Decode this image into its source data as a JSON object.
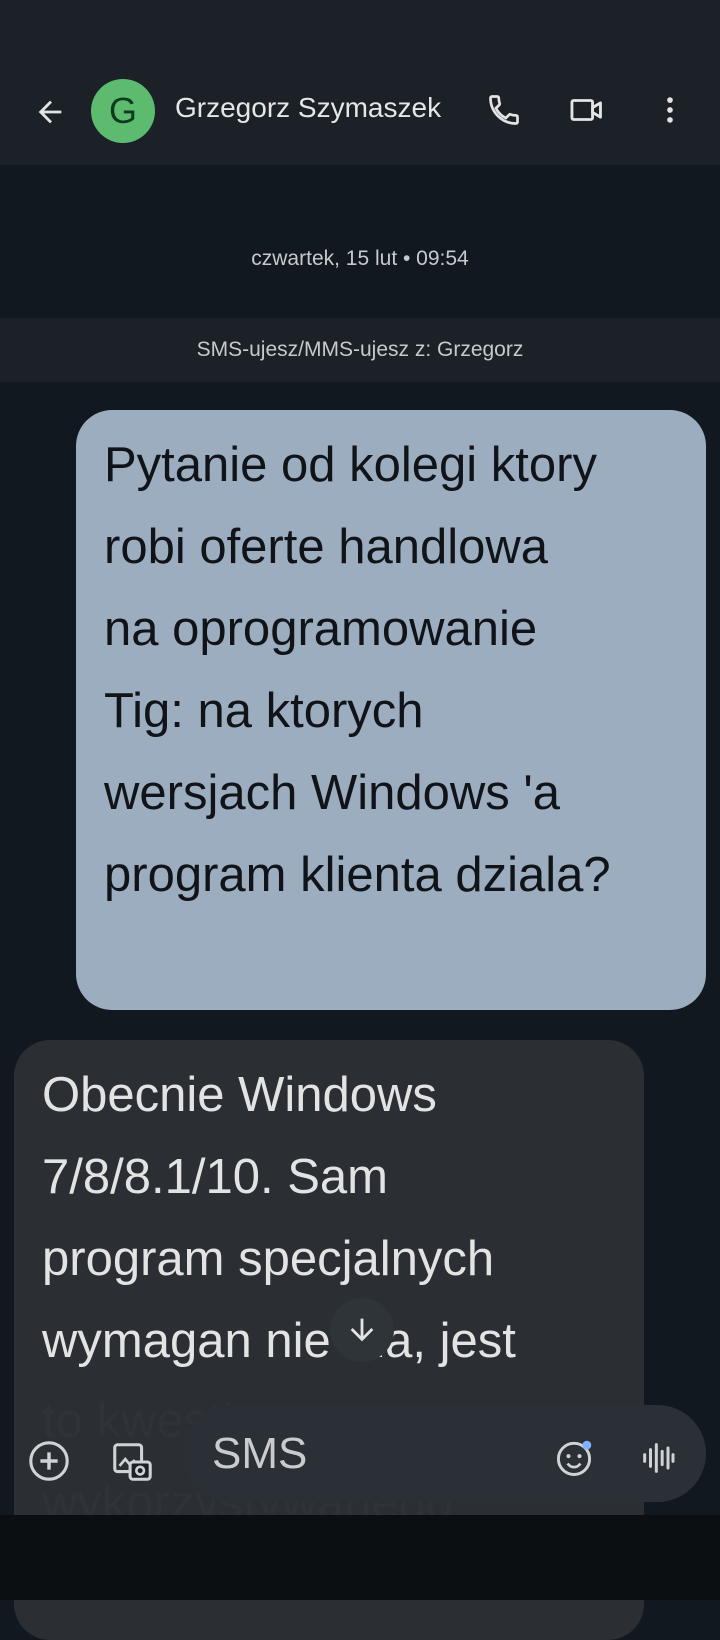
{
  "header": {
    "back_icon": "arrow-back-icon",
    "avatar_letter": "G",
    "avatar_color": "#5dbb6f",
    "contact_name": "Grzegorz Szymaszek",
    "call_icon": "phone-icon",
    "video_icon": "video-camera-icon",
    "more_icon": "more-vert-icon"
  },
  "conversation": {
    "date_label": "czwartek, 15 lut • 09:54",
    "sim_banner": "SMS-ujesz/MMS-ujesz z: Grzegorz",
    "messages": [
      {
        "direction": "outgoing",
        "text": "Pytanie od kolegi ktory\nrobi oferte handlowa\nna oprogramowanie\nTig: na ktorych\nwersjach Windows 'a\nprogram klienta dziala?"
      },
      {
        "direction": "incoming",
        "text": "Obecnie Windows\n7/8/8.1/10. Sam\nprogram specjalnych\nwymagan nie ma, jest",
        "hidden_continuation": "to kwestia\nwykorzystywanego\nframeworka - Electron"
      }
    ],
    "scroll_down_icon": "arrow-down-icon"
  },
  "compose": {
    "add_icon": "add-circle-icon",
    "gallery_icon": "gallery-icon",
    "placeholder": "SMS",
    "emoji_icon": "emoji-icon",
    "voice_icon": "voice-waveform-icon"
  },
  "colors": {
    "outgoing_bubble": "#9cadbf",
    "incoming_bubble": "#2b2f34",
    "background": "#121820"
  }
}
